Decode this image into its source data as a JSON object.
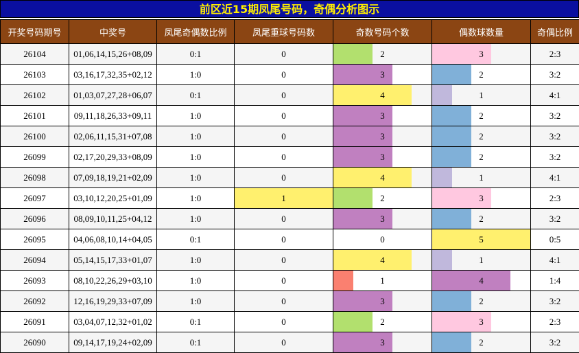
{
  "title": "前区近15期凤尾号码，奇偶分析图示",
  "headers": [
    "开奖号码期号",
    "中奖号",
    "凤尾奇偶数比例",
    "凤尾重球号码数",
    "奇数号码个数",
    "偶数球数量",
    "奇偶比例"
  ],
  "colors": {
    "title_bg": "#0a0fa0",
    "title_text": "#ffef00",
    "header_bg": "#8b4513",
    "highlight": "#fff06e",
    "count_colors": {
      "0": "#ffffff",
      "1": "#c0b8dc",
      "2": "#b2e06e",
      "3": "#c080c0",
      "4": "#fff06e",
      "5": "#fff06e"
    },
    "even_count_colors": {
      "0": "#ffffff",
      "1": "#c0b8dc",
      "2": "#80b0d8",
      "3": "#ffc8e0",
      "4": "#c080c0",
      "5": "#fff06e"
    },
    "odd_one_color": "#fa8070"
  },
  "chart_data": {
    "type": "table",
    "max_count": 5,
    "rows": [
      {
        "period": "26104",
        "numbers": "01,06,14,15,26+08,09",
        "tail_ratio": "0:1",
        "tail_repeat": 0,
        "odd": 2,
        "even": 3,
        "ratio": "2:3"
      },
      {
        "period": "26103",
        "numbers": "03,16,17,32,35+02,12",
        "tail_ratio": "1:0",
        "tail_repeat": 0,
        "odd": 3,
        "even": 2,
        "ratio": "3:2"
      },
      {
        "period": "26102",
        "numbers": "01,03,07,27,28+06,07",
        "tail_ratio": "0:1",
        "tail_repeat": 0,
        "odd": 4,
        "even": 1,
        "ratio": "4:1"
      },
      {
        "period": "26101",
        "numbers": "09,11,18,26,33+09,11",
        "tail_ratio": "1:0",
        "tail_repeat": 0,
        "odd": 3,
        "even": 2,
        "ratio": "3:2"
      },
      {
        "period": "26100",
        "numbers": "02,06,11,15,31+07,08",
        "tail_ratio": "1:0",
        "tail_repeat": 0,
        "odd": 3,
        "even": 2,
        "ratio": "3:2"
      },
      {
        "period": "26099",
        "numbers": "02,17,20,29,33+08,09",
        "tail_ratio": "1:0",
        "tail_repeat": 0,
        "odd": 3,
        "even": 2,
        "ratio": "3:2"
      },
      {
        "period": "26098",
        "numbers": "07,09,18,19,21+02,09",
        "tail_ratio": "1:0",
        "tail_repeat": 0,
        "odd": 4,
        "even": 1,
        "ratio": "4:1"
      },
      {
        "period": "26097",
        "numbers": "03,10,12,20,25+01,09",
        "tail_ratio": "1:0",
        "tail_repeat": 1,
        "odd": 2,
        "even": 3,
        "ratio": "2:3"
      },
      {
        "period": "26096",
        "numbers": "08,09,10,11,25+04,12",
        "tail_ratio": "1:0",
        "tail_repeat": 0,
        "odd": 3,
        "even": 2,
        "ratio": "3:2"
      },
      {
        "period": "26095",
        "numbers": "04,06,08,10,14+04,05",
        "tail_ratio": "0:1",
        "tail_repeat": 0,
        "odd": 0,
        "even": 5,
        "ratio": "0:5"
      },
      {
        "period": "26094",
        "numbers": "05,14,15,17,33+01,07",
        "tail_ratio": "1:0",
        "tail_repeat": 0,
        "odd": 4,
        "even": 1,
        "ratio": "4:1"
      },
      {
        "period": "26093",
        "numbers": "08,10,22,26,29+03,10",
        "tail_ratio": "1:0",
        "tail_repeat": 0,
        "odd": 1,
        "even": 4,
        "ratio": "1:4"
      },
      {
        "period": "26092",
        "numbers": "12,16,19,29,33+07,09",
        "tail_ratio": "1:0",
        "tail_repeat": 0,
        "odd": 3,
        "even": 2,
        "ratio": "3:2"
      },
      {
        "period": "26091",
        "numbers": "03,04,07,12,32+01,02",
        "tail_ratio": "0:1",
        "tail_repeat": 0,
        "odd": 2,
        "even": 3,
        "ratio": "2:3"
      },
      {
        "period": "26090",
        "numbers": "09,14,17,19,24+02,09",
        "tail_ratio": "0:1",
        "tail_repeat": 0,
        "odd": 3,
        "even": 2,
        "ratio": "3:2"
      }
    ]
  }
}
